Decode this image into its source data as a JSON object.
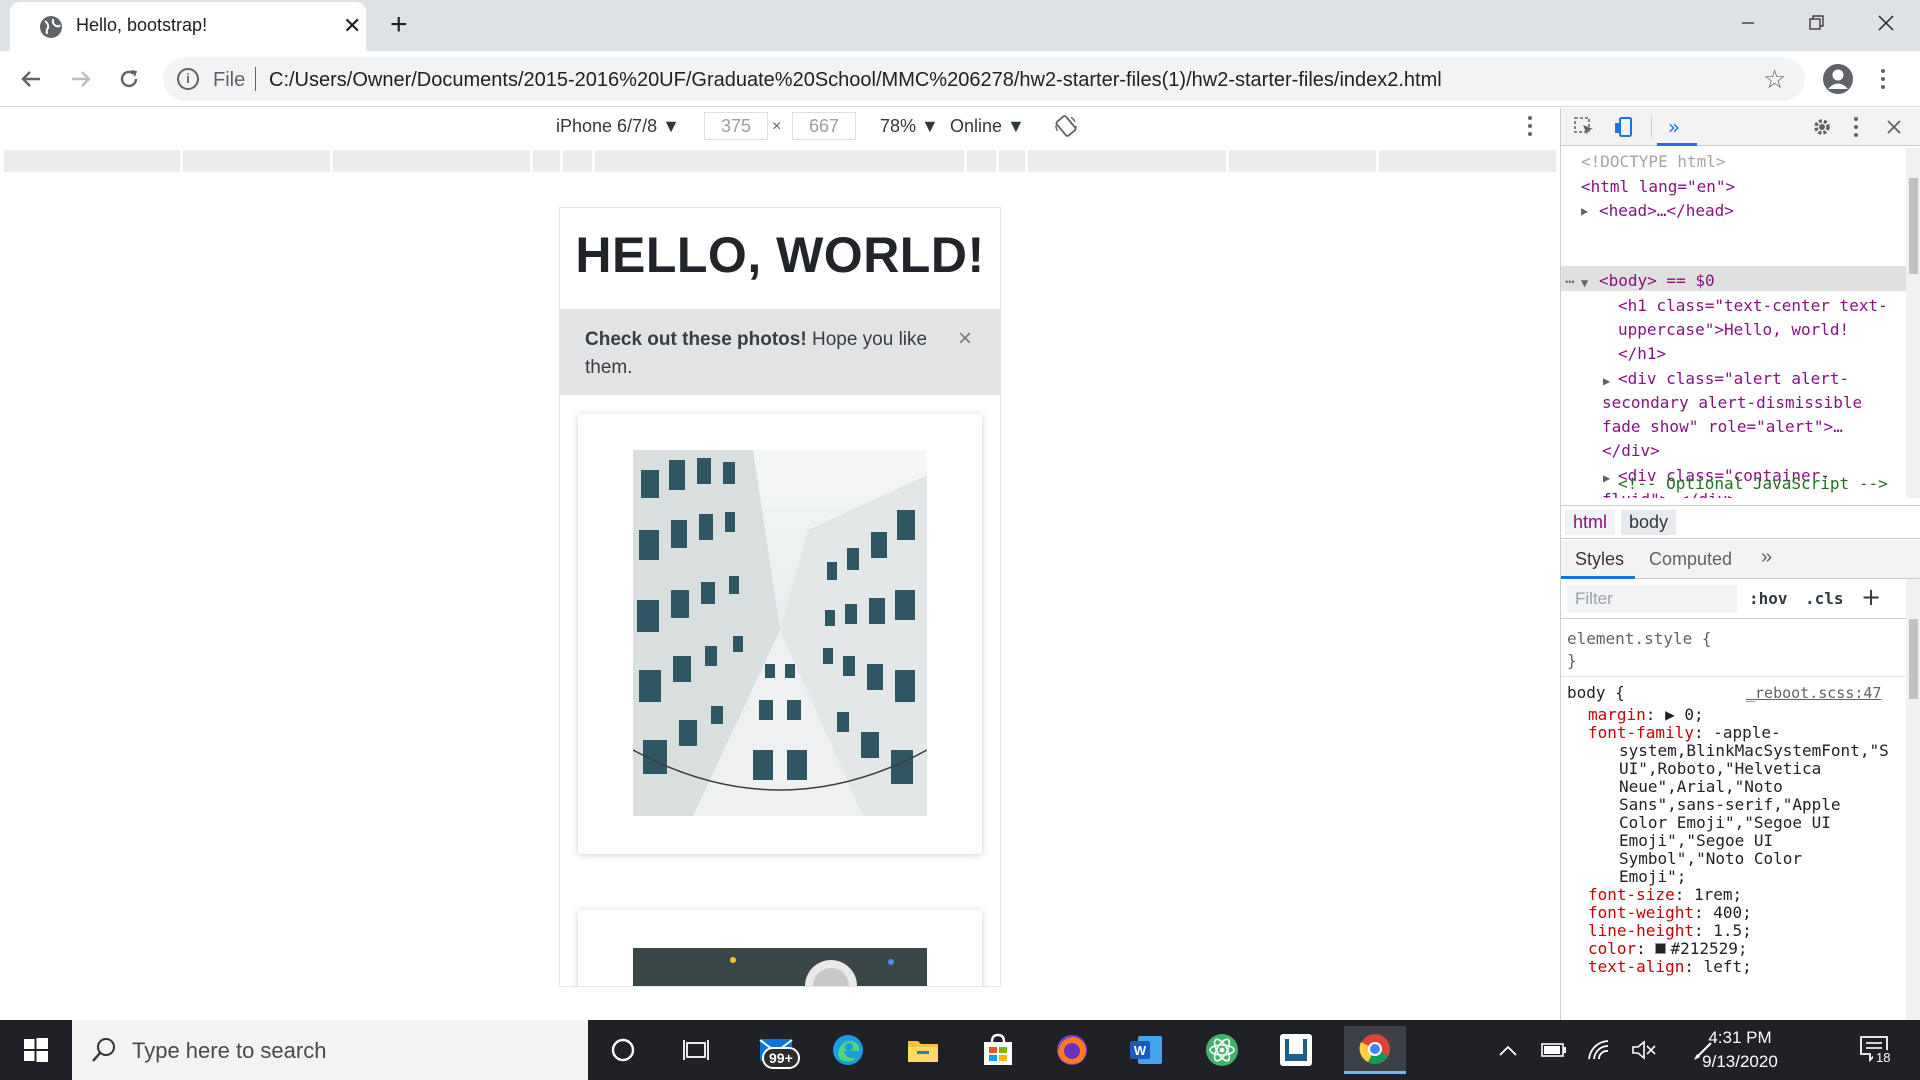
{
  "browser": {
    "tab_title": "Hello, bootstrap!",
    "file_label": "File",
    "url": "C:/Users/Owner/Documents/2015-2016%20UF/Graduate%20School/MMC%206278/hw2-starter-files(1)/hw2-starter-files/index2.html"
  },
  "device_toolbar": {
    "device": "iPhone 6/7/8 ▼",
    "width": "375",
    "height": "667",
    "times": "×",
    "zoom": "78% ▼",
    "network": "Online ▼"
  },
  "page": {
    "title": "HELLO, WORLD!",
    "alert_strong": "Check out these photos!",
    "alert_text": " Hope you like them.",
    "alert_close": "×"
  },
  "devtools": {
    "dom_lines": [
      "<!DOCTYPE html>",
      "<html lang=\"en\">",
      "<head>…</head>",
      "<body> == $0",
      "<h1 class=\"text-center text-",
      "uppercase\">Hello, world!",
      "</h1>",
      "<div class=\"alert alert-",
      "secondary alert-dismissible",
      "fade show\" role=\"alert\">…",
      "</div>",
      "<div class=\"container-",
      "fluid\">…</div>",
      "<!-- Optional JavaScript -->"
    ],
    "breadcrumbs": [
      "html",
      "body"
    ],
    "tabs": {
      "styles": "Styles",
      "computed": "Computed",
      "more": "»"
    },
    "filter_placeholder": "Filter",
    "hov": ":hov",
    "cls": ".cls",
    "plus": "+",
    "element_style": "element.style {",
    "close_brace": "}",
    "body_selector": "body {",
    "source_link": "_reboot.scss:47",
    "css_props": [
      {
        "prop": "margin",
        "sep": ": ▶ ",
        "val": "0;"
      },
      {
        "prop": "font-family",
        "sep": ": ",
        "val": "-apple-"
      },
      {
        "prop": "",
        "sep": "",
        "val": "system,BlinkMacSystemFont,\"S"
      },
      {
        "prop": "",
        "sep": "",
        "val": "UI\",Roboto,\"Helvetica"
      },
      {
        "prop": "",
        "sep": "",
        "val": "Neue\",Arial,\"Noto"
      },
      {
        "prop": "",
        "sep": "",
        "val": "Sans\",sans-serif,\"Apple"
      },
      {
        "prop": "",
        "sep": "",
        "val": "Color Emoji\",\"Segoe UI"
      },
      {
        "prop": "",
        "sep": "",
        "val": "Emoji\",\"Segoe UI"
      },
      {
        "prop": "",
        "sep": "",
        "val": "Symbol\",\"Noto Color"
      },
      {
        "prop": "",
        "sep": "",
        "val": "Emoji\";"
      },
      {
        "prop": "font-size",
        "sep": ": ",
        "val": "1rem;"
      },
      {
        "prop": "font-weight",
        "sep": ": ",
        "val": "400;"
      },
      {
        "prop": "line-height",
        "sep": ": ",
        "val": "1.5;"
      },
      {
        "prop": "color",
        "sep": ": ",
        "val": "#212529;"
      },
      {
        "prop": "text-align",
        "sep": ": ",
        "val": "left;"
      }
    ]
  },
  "taskbar": {
    "search_placeholder": "Type here to search",
    "mail_badge": "99+",
    "time": "4:31 PM",
    "date": "9/13/2020",
    "notification_count": "18"
  },
  "colors": {
    "tab_strip": "#dee1e6",
    "alert_bg": "#e2e3e5",
    "taskbar": "#1f2126",
    "accent": "#1a73e8"
  }
}
